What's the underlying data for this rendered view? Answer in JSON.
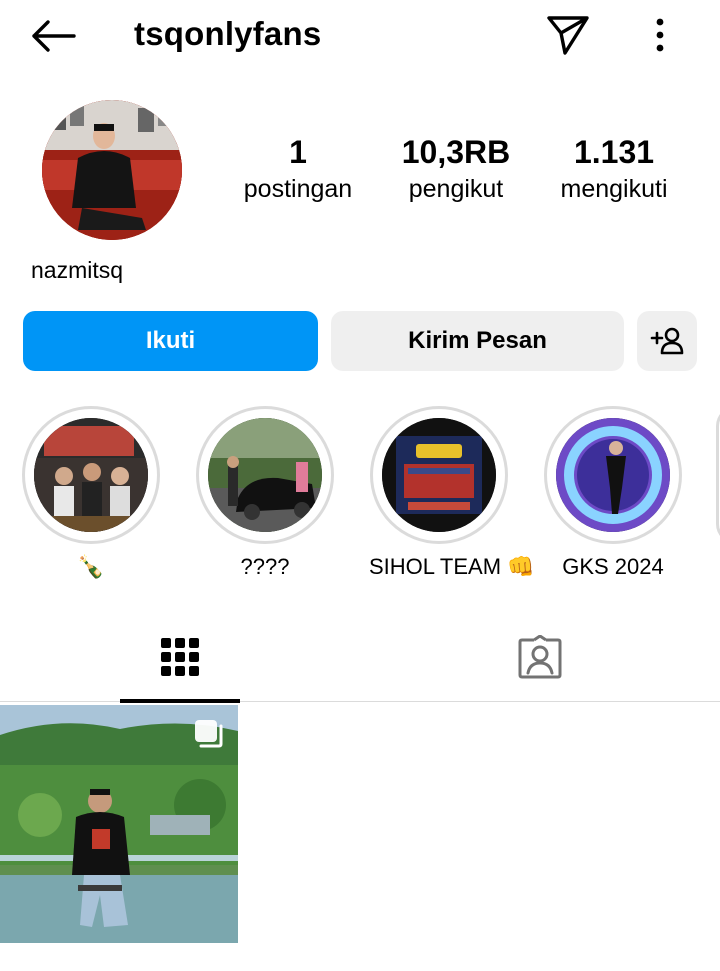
{
  "header": {
    "username": "tsqonlyfans",
    "back_icon": "arrow-left-icon",
    "send_icon": "paper-plane-icon",
    "more_icon": "vertical-dots-icon"
  },
  "profile": {
    "avatar_alt": "profile-photo",
    "name": "nazmitsq",
    "stats": {
      "posts": {
        "value": "1",
        "label": "postingan"
      },
      "followers": {
        "value": "10,3RB",
        "label": "pengikut"
      },
      "following": {
        "value": "1.131",
        "label": "mengikuti"
      }
    }
  },
  "actions": {
    "follow_label": "Ikuti",
    "message_label": "Kirim Pesan",
    "suggest_icon": "add-person-icon"
  },
  "highlights": [
    {
      "caption": "🍾"
    },
    {
      "caption": "????"
    },
    {
      "caption": "SIHOL TEAM 👊"
    },
    {
      "caption": "GKS 2024"
    }
  ],
  "tabs": [
    {
      "name": "posts-grid",
      "icon": "grid-icon",
      "active": true
    },
    {
      "name": "tagged",
      "icon": "tagged-person-icon",
      "active": false
    }
  ],
  "posts": [
    {
      "type": "carousel",
      "icon": "multiple-posts-icon"
    }
  ],
  "colors": {
    "accent": "#0095f6",
    "secondary_button": "#efefef",
    "ring": "#dbdbdb"
  }
}
